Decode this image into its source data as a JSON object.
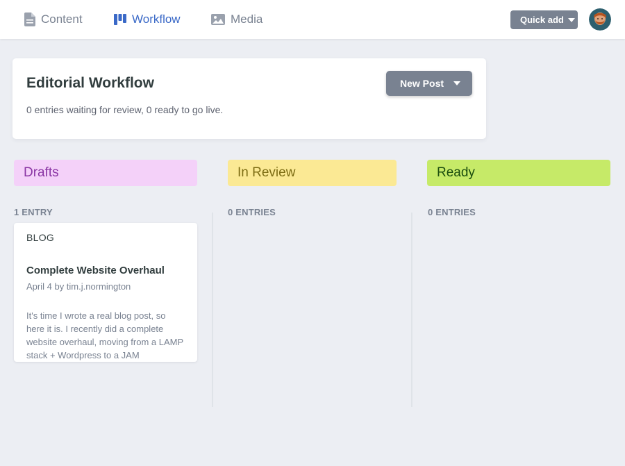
{
  "nav": {
    "items": [
      {
        "label": "Content",
        "icon": "document-icon"
      },
      {
        "label": "Workflow",
        "icon": "kanban-icon"
      },
      {
        "label": "Media",
        "icon": "image-icon"
      }
    ],
    "active": "Workflow",
    "quick_add_label": "Quick add"
  },
  "header": {
    "title": "Editorial Workflow",
    "description": "0 entries waiting for review, 0 ready to go live.",
    "new_post_label": "New Post"
  },
  "columns": [
    {
      "title": "Drafts",
      "count_label": "1 ENTRY",
      "color": "#f4d1f9",
      "text_color": "#8a35a4"
    },
    {
      "title": "In Review",
      "count_label": "0 ENTRIES",
      "color": "#fbe994",
      "text_color": "#7d6d14"
    },
    {
      "title": "Ready",
      "count_label": "0 ENTRIES",
      "color": "#c6ea68",
      "text_color": "#1b4d0e"
    }
  ],
  "entries": [
    {
      "collection": "BLOG",
      "title": "Complete Website Overhaul",
      "meta": "April 4 by tim.j.normington",
      "excerpt": "It's time I wrote a real blog post, so here it is. I recently did a complete website overhaul, moving from a LAMP stack + Wordpress to a JAM"
    }
  ],
  "colors": {
    "accent": "#3a69c7",
    "button_gray": "#798291",
    "background": "#eceef3"
  }
}
